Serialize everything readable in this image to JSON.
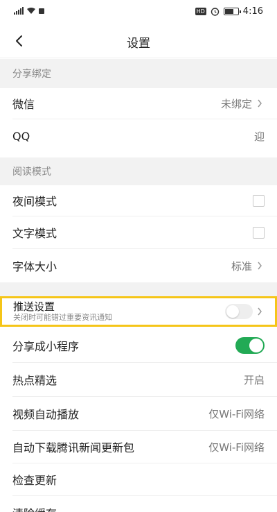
{
  "status_bar": {
    "time": "4:16",
    "hd_badge": "HD"
  },
  "nav": {
    "title": "设置"
  },
  "sections": {
    "share_binding": "分享绑定",
    "reading_mode": "阅读模式"
  },
  "share": {
    "wechat": {
      "label": "微信",
      "value": "未绑定"
    },
    "qq": {
      "label": "QQ",
      "value": "迎"
    }
  },
  "reading": {
    "night": {
      "label": "夜间模式"
    },
    "text": {
      "label": "文字模式"
    },
    "font": {
      "label": "字体大小",
      "value": "标准"
    }
  },
  "push": {
    "label": "推送设置",
    "hint": "关闭时可能错过重要资讯通知"
  },
  "settings": {
    "share_mini": {
      "label": "分享成小程序",
      "toggle_on": true
    },
    "hot_pick": {
      "label": "热点精选",
      "value": "开启"
    },
    "video_autoplay": {
      "label": "视频自动播放",
      "value": "仅Wi-Fi网络"
    },
    "auto_download": {
      "label": "自动下载腾讯新闻更新包",
      "value": "仅Wi-Fi网络"
    },
    "check_update": {
      "label": "检查更新"
    },
    "clear_cache": {
      "label": "清除缓存"
    }
  },
  "colors": {
    "accent_green": "#22aa55",
    "highlight": "#f5c518"
  }
}
